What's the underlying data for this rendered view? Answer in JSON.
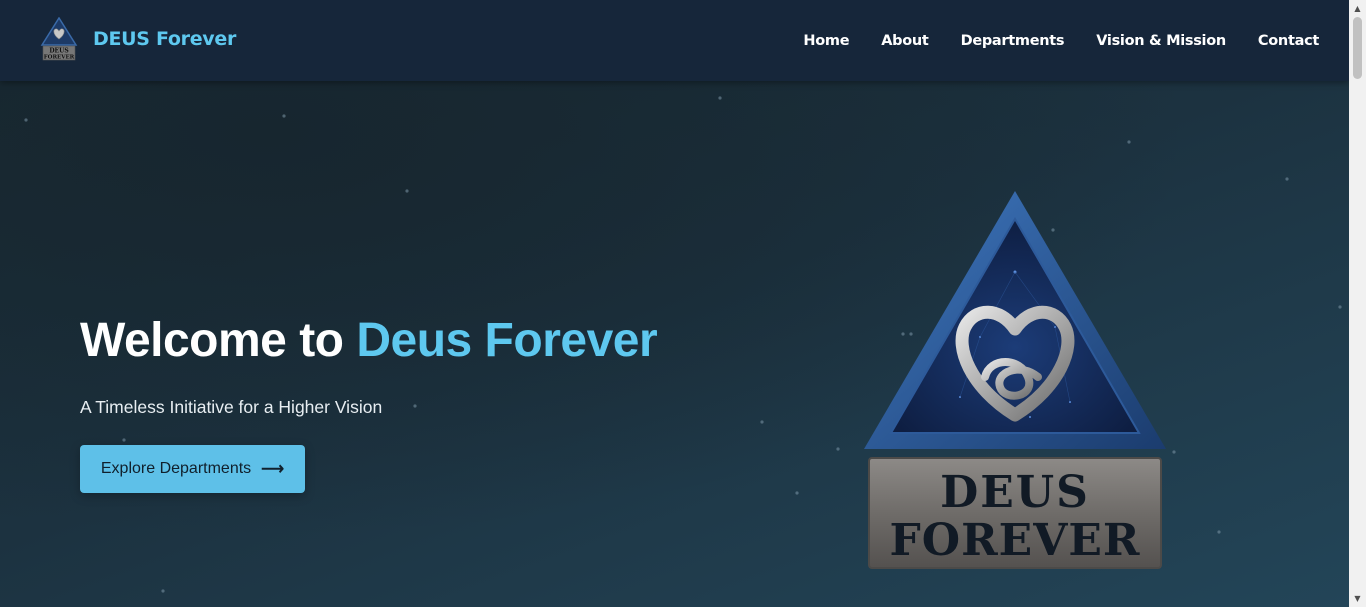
{
  "brand": {
    "name": "DEUS Forever",
    "logo_text_line1": "DEUS",
    "logo_text_line2": "FOREVER"
  },
  "nav": {
    "items": [
      {
        "label": "Home"
      },
      {
        "label": "About"
      },
      {
        "label": "Departments"
      },
      {
        "label": "Vision & Mission"
      },
      {
        "label": "Contact"
      }
    ]
  },
  "hero": {
    "title_prefix": "Welcome to ",
    "title_accent": "Deus Forever",
    "subtitle": "A Timeless Initiative for a Higher Vision",
    "cta_label": "Explore Departments",
    "cta_icon": "arrow-right-icon"
  },
  "emblem": {
    "text_line1": "DEUS",
    "text_line2": "FOREVER",
    "icon": "heart-knot-icon"
  },
  "colors": {
    "accent": "#5ec8ef",
    "navbar": "#16263a",
    "button": "#5ec0e8"
  }
}
